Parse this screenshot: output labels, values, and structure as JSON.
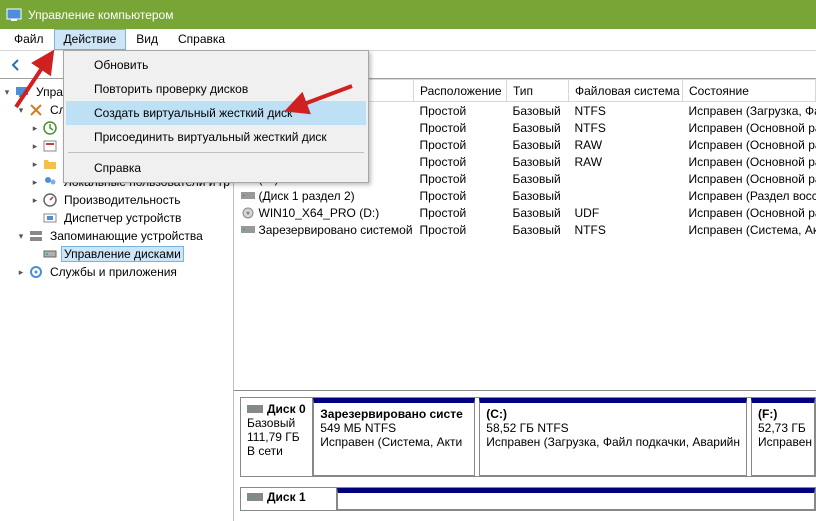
{
  "window": {
    "title": "Управление компьютером"
  },
  "menubar": {
    "items": [
      "Файл",
      "Действие",
      "Вид",
      "Справка"
    ],
    "open_index": 1
  },
  "dropdown": {
    "groups": [
      [
        "Обновить",
        "Повторить проверку дисков",
        "Создать виртуальный жесткий диск",
        "Присоединить виртуальный жесткий диск"
      ],
      [
        "Справка"
      ]
    ],
    "highlight": "Создать виртуальный жесткий диск"
  },
  "tree": {
    "root": "Управление компьютером (Локал",
    "system_tools": {
      "label": "Служебные программы",
      "children": [
        "Планировщик заданий",
        "Просмотр событий",
        "Общие папки",
        "Локальные пользователи и гр",
        "Производительность",
        "Диспетчер устройств"
      ]
    },
    "storage": {
      "label": "Запоминающие устройства",
      "child": "Управление дисками"
    },
    "services": {
      "label": "Службы и приложения"
    }
  },
  "volumes": {
    "headers": {
      "volume": "Том",
      "layout": "Расположение",
      "type": "Тип",
      "fs": "Файловая система",
      "status": "Состояние"
    },
    "rows": [
      {
        "name": "",
        "layout": "Простой",
        "type": "Базовый",
        "fs": "NTFS",
        "status": "Исправен (Загрузка, Фа"
      },
      {
        "name": "",
        "layout": "Простой",
        "type": "Базовый",
        "fs": "NTFS",
        "status": "Исправен (Основной ра"
      },
      {
        "name": "",
        "layout": "Простой",
        "type": "Базовый",
        "fs": "RAW",
        "status": "Исправен (Основной ра"
      },
      {
        "name": "",
        "layout": "Простой",
        "type": "Базовый",
        "fs": "RAW",
        "status": "Исправен (Основной ра"
      },
      {
        "name": "(H:)",
        "layout": "Простой",
        "type": "Базовый",
        "fs": "",
        "status": "Исправен (Основной ра"
      },
      {
        "name": "(Диск 1 раздел 2)",
        "layout": "Простой",
        "type": "Базовый",
        "fs": "",
        "status": "Исправен (Раздел восст"
      },
      {
        "name": "WIN10_X64_PRO (D:)",
        "layout": "Простой",
        "type": "Базовый",
        "fs": "UDF",
        "status": "Исправен (Основной ра"
      },
      {
        "name": "Зарезервировано системой",
        "layout": "Простой",
        "type": "Базовый",
        "fs": "NTFS",
        "status": "Исправен (Система, Ак"
      }
    ]
  },
  "disks": {
    "disk0": {
      "title": "Диск 0",
      "type": "Базовый",
      "size": "111,79 ГБ",
      "status": "В сети",
      "parts": [
        {
          "name": "Зарезервировано систе",
          "size": "549 МБ NTFS",
          "status": "Исправен (Система, Акти"
        },
        {
          "name": "(C:)",
          "size": "58,52 ГБ NTFS",
          "status": "Исправен (Загрузка, Файл подкачки, Аварийн"
        },
        {
          "name": "(F:)",
          "size": "52,73 ГБ",
          "status": "Исправен"
        }
      ]
    },
    "disk1": {
      "title": "Диск 1"
    }
  }
}
